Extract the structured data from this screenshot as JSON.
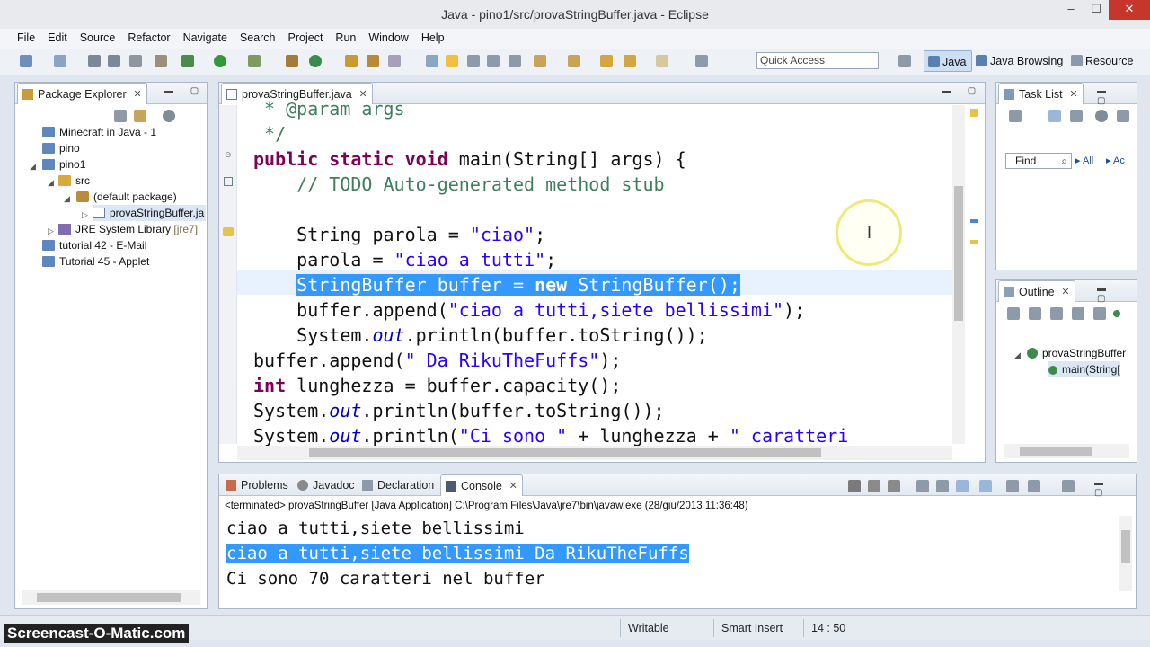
{
  "window": {
    "title": "Java - pino1/src/provaStringBuffer.java - Eclipse",
    "min": "–",
    "max": "☐",
    "close": "✕"
  },
  "menu": [
    "File",
    "Edit",
    "Source",
    "Refactor",
    "Navigate",
    "Search",
    "Project",
    "Run",
    "Window",
    "Help"
  ],
  "toolbar": {
    "quick_access": "Quick Access",
    "perspectives": [
      "Java",
      "Java Browsing",
      "Resource"
    ]
  },
  "package_explorer": {
    "title": "Package Explorer",
    "items": [
      {
        "label": "Minecraft in Java - 1"
      },
      {
        "label": "pino"
      },
      {
        "label": "pino1"
      },
      {
        "label": "src"
      },
      {
        "label": "(default package)"
      },
      {
        "label": "provaStringBuffer.ja"
      },
      {
        "label": "JRE System Library",
        "suffix": "[jre7]"
      },
      {
        "label": "tutorial 42 - E-Mail"
      },
      {
        "label": "Tutorial 45 - Applet"
      }
    ]
  },
  "editor": {
    "tab": "provaStringBuffer.java",
    "lines": {
      "l1": " * @param args",
      "l2": " */",
      "l3_kw": "public static void",
      "l3_rest": " main(String[] args) {",
      "l4_com": "// TODO Auto-generated method stub",
      "l6_a": "String parola = ",
      "l6_s": "\"ciao\"",
      "l6_e": ";",
      "l7_a": "parola = ",
      "l7_s": "\"ciao a tutti\"",
      "l7_e": ";",
      "l8_a": "StringBuffer buffer = ",
      "l8_kw": "new",
      "l8_e": " StringBuffer();",
      "l9_a": "buffer.append(",
      "l9_s": "\"ciao a tutti,siete bellissimi\"",
      "l9_e": ");",
      "l10_a": "System.",
      "l10_i": "out",
      "l10_e": ".println(buffer.toString());",
      "l11_a": "buffer.append(",
      "l11_s": "\" Da RikuTheFuffs\"",
      "l11_e": ");",
      "l12_kw": "int",
      "l12_e": " lunghezza = buffer.capacity();",
      "l13_a": "System.",
      "l13_i": "out",
      "l13_e": ".println(buffer.toString());",
      "l14_a": "System.",
      "l14_i": "out",
      "l14_b": ".println(",
      "l14_s": "\"Ci sono \"",
      "l14_c": " + lunghezza + ",
      "l14_s2": "\" caratteri"
    }
  },
  "task_list": {
    "title": "Task List",
    "find": "Find",
    "all": "All",
    "act": "Ac"
  },
  "outline": {
    "title": "Outline",
    "class": "provaStringBuffer",
    "method": "main(String["
  },
  "console": {
    "tabs": [
      "Problems",
      "Javadoc",
      "Declaration",
      "Console"
    ],
    "header": "<terminated> provaStringBuffer [Java Application] C:\\Program Files\\Java\\jre7\\bin\\javaw.exe (28/giu/2013 11:36:48)",
    "lines": [
      "ciao a tutti,siete bellissimi",
      "ciao a tutti,siete bellissimi Da RikuTheFuffs",
      "Ci sono 70 caratteri nel buffer"
    ]
  },
  "status": {
    "writable": "Writable",
    "insert": "Smart Insert",
    "pos": "14 : 50"
  },
  "watermark": "Screencast-O-Matic.com"
}
